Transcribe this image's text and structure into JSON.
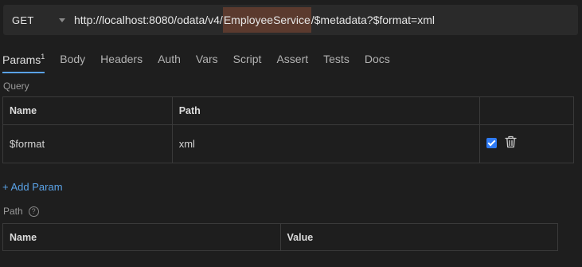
{
  "request": {
    "method": "GET",
    "url_prefix": "http://localhost:8080/odata/v4/",
    "url_highlight": "EmployeeService",
    "url_suffix": "/$metadata?$format=xml"
  },
  "tabs": [
    {
      "label": "Params",
      "badge": "1",
      "active": true
    },
    {
      "label": "Body"
    },
    {
      "label": "Headers"
    },
    {
      "label": "Auth"
    },
    {
      "label": "Vars"
    },
    {
      "label": "Script"
    },
    {
      "label": "Assert"
    },
    {
      "label": "Tests"
    },
    {
      "label": "Docs"
    }
  ],
  "query": {
    "title": "Query",
    "columns": [
      "Name",
      "Path"
    ],
    "rows": [
      {
        "name": "$format",
        "value": "xml",
        "enabled": true
      }
    ],
    "add_label": "+ Add Param"
  },
  "path_section": {
    "title": "Path",
    "help_glyph": "?",
    "columns": [
      "Name",
      "Value"
    ]
  },
  "colors": {
    "accent": "#5aa2e6",
    "checkbox": "#2f7bf5",
    "highlight": "#5b3a2e"
  }
}
